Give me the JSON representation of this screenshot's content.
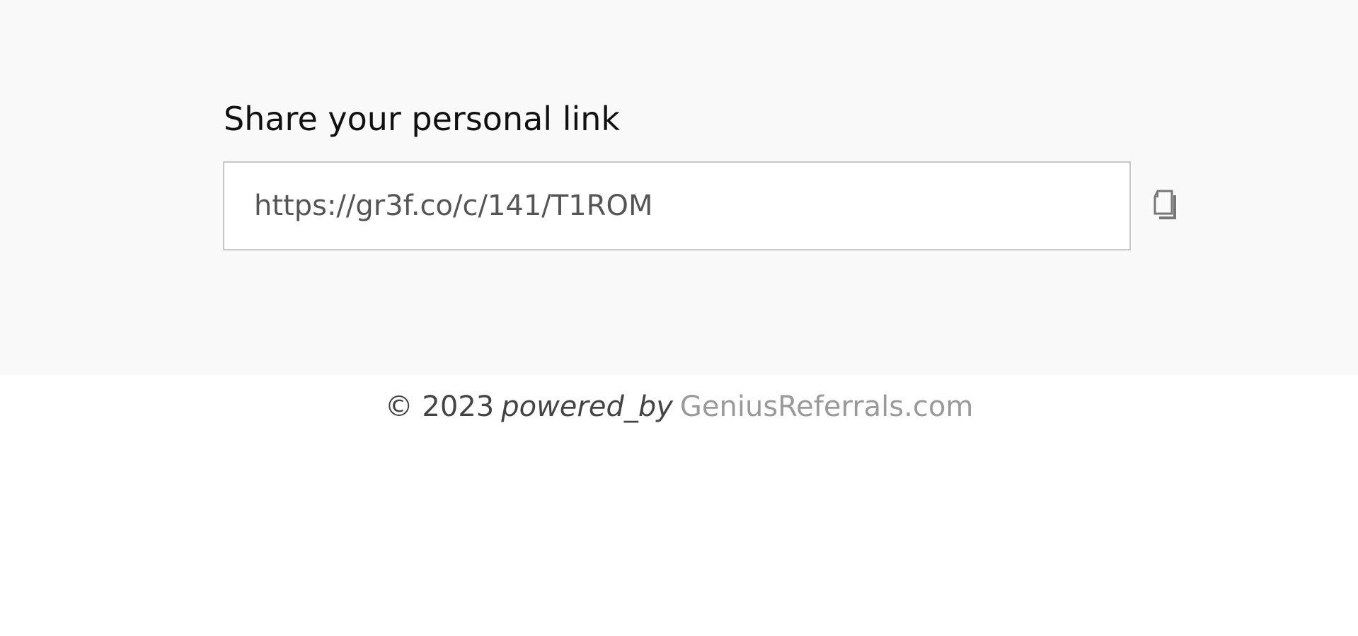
{
  "share": {
    "title": "Share your personal link",
    "link_value": "https://gr3f.co/c/141/T1ROM"
  },
  "icons": {
    "copy": "copy-icon"
  },
  "footer": {
    "copyright": "© 2023",
    "powered_by": "powered_by",
    "brand_link": "GeniusReferrals.com"
  },
  "colors": {
    "section_bg": "#f9f9f9",
    "page_bg": "#ffffff",
    "input_border": "#c8c8c8",
    "link_text": "#555555",
    "brand_link": "#9a9a9a"
  }
}
